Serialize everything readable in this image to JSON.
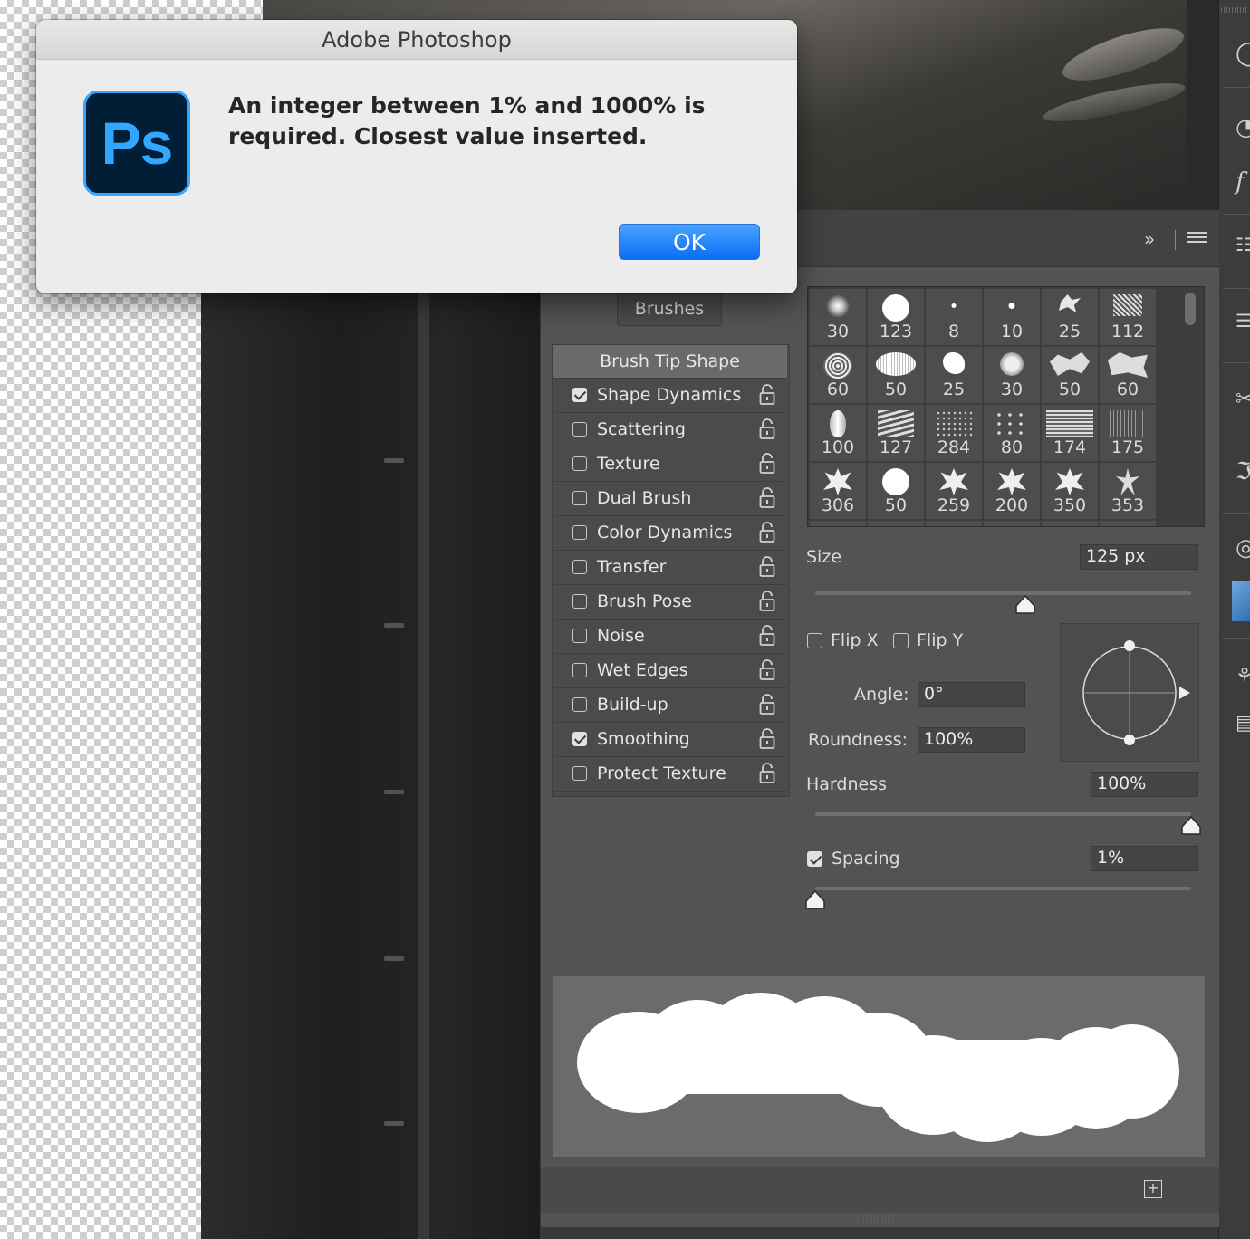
{
  "dialog": {
    "title": "Adobe Photoshop",
    "app_icon": "photoshop-app-icon",
    "logo_text": "Ps",
    "message": "An integer between 1% and 1000% is required.  Closest value inserted.",
    "ok_label": "OK"
  },
  "panel": {
    "collapse_icon": "double-chevron-right-icon",
    "menu_icon": "hamburger-menu-icon",
    "brushes_button": "Brushes",
    "settings": [
      {
        "label": "Brush Tip Shape",
        "header": true
      },
      {
        "label": "Shape Dynamics",
        "checked": true
      },
      {
        "label": "Scattering",
        "checked": false
      },
      {
        "label": "Texture",
        "checked": false
      },
      {
        "label": "Dual Brush",
        "checked": false
      },
      {
        "label": "Color Dynamics",
        "checked": false
      },
      {
        "label": "Transfer",
        "checked": false
      },
      {
        "label": "Brush Pose",
        "checked": false
      },
      {
        "label": "Noise",
        "checked": false
      },
      {
        "label": "Wet Edges",
        "checked": false
      },
      {
        "label": "Build-up",
        "checked": false
      },
      {
        "label": "Smoothing",
        "checked": true
      },
      {
        "label": "Protect Texture",
        "checked": false
      }
    ],
    "brush_tips": [
      "30",
      "123",
      "8",
      "10",
      "25",
      "112",
      "60",
      "50",
      "25",
      "30",
      "50",
      "60",
      "100",
      "127",
      "284",
      "80",
      "174",
      "175",
      "306",
      "50",
      "259",
      "200",
      "350",
      "353"
    ],
    "size": {
      "label": "Size",
      "value": "125 px",
      "slider_fraction": 0.56
    },
    "flip_x": {
      "label": "Flip X",
      "checked": false
    },
    "flip_y": {
      "label": "Flip Y",
      "checked": false
    },
    "angle": {
      "label": "Angle:",
      "value": "0°"
    },
    "roundness": {
      "label": "Roundness:",
      "value": "100%"
    },
    "hardness": {
      "label": "Hardness",
      "value": "100%",
      "slider_fraction": 1.0
    },
    "spacing": {
      "label": "Spacing",
      "value": "1%",
      "checked": true,
      "slider_fraction": 0.0
    },
    "new_preset_icon": "new-brush-preset-icon",
    "accent_color": "#0a6cf5"
  }
}
